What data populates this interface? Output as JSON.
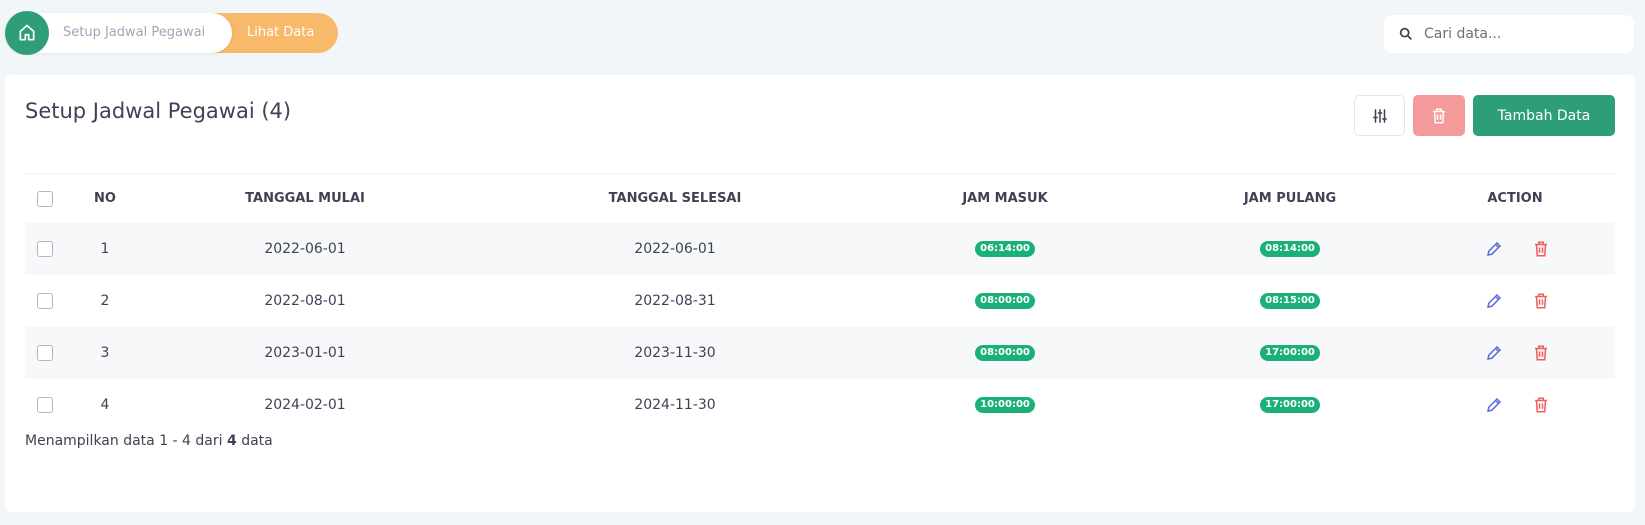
{
  "breadcrumb": {
    "home_icon": "home-icon",
    "setup_label": "Setup Jadwal Pegawai",
    "current_label": "Lihat Data"
  },
  "search": {
    "placeholder": "Cari data...",
    "value": "",
    "icon": "search-icon"
  },
  "page": {
    "title": "Setup Jadwal Pegawai (4)"
  },
  "toolbar": {
    "filter_icon": "sliders-icon",
    "delete_icon": "trash-icon",
    "add_label": "Tambah Data"
  },
  "table": {
    "headers": {
      "no": "NO",
      "mulai": "TANGGAL MULAI",
      "selesai": "TANGGAL SELESAI",
      "masuk": "JAM MASUK",
      "pulang": "JAM PULANG",
      "action": "ACTION"
    },
    "rows": [
      {
        "no": "1",
        "mulai": "2022-06-01",
        "selesai": "2022-06-01",
        "masuk": "06:14:00",
        "pulang": "08:14:00"
      },
      {
        "no": "2",
        "mulai": "2022-08-01",
        "selesai": "2022-08-31",
        "masuk": "08:00:00",
        "pulang": "08:15:00"
      },
      {
        "no": "3",
        "mulai": "2023-01-01",
        "selesai": "2023-11-30",
        "masuk": "08:00:00",
        "pulang": "17:00:00"
      },
      {
        "no": "4",
        "mulai": "2024-02-01",
        "selesai": "2024-11-30",
        "masuk": "10:00:00",
        "pulang": "17:00:00"
      }
    ]
  },
  "footer": {
    "prefix": "Menampilkan data 1 - 4 dari",
    "total": "4",
    "suffix": "data"
  },
  "colors": {
    "primary": "#2e9e77",
    "warning": "#f8b96a",
    "badge": "#1bb077",
    "danger": "#f15c5c",
    "danger_light": "#f59a9a",
    "edit": "#5b6bd6"
  }
}
